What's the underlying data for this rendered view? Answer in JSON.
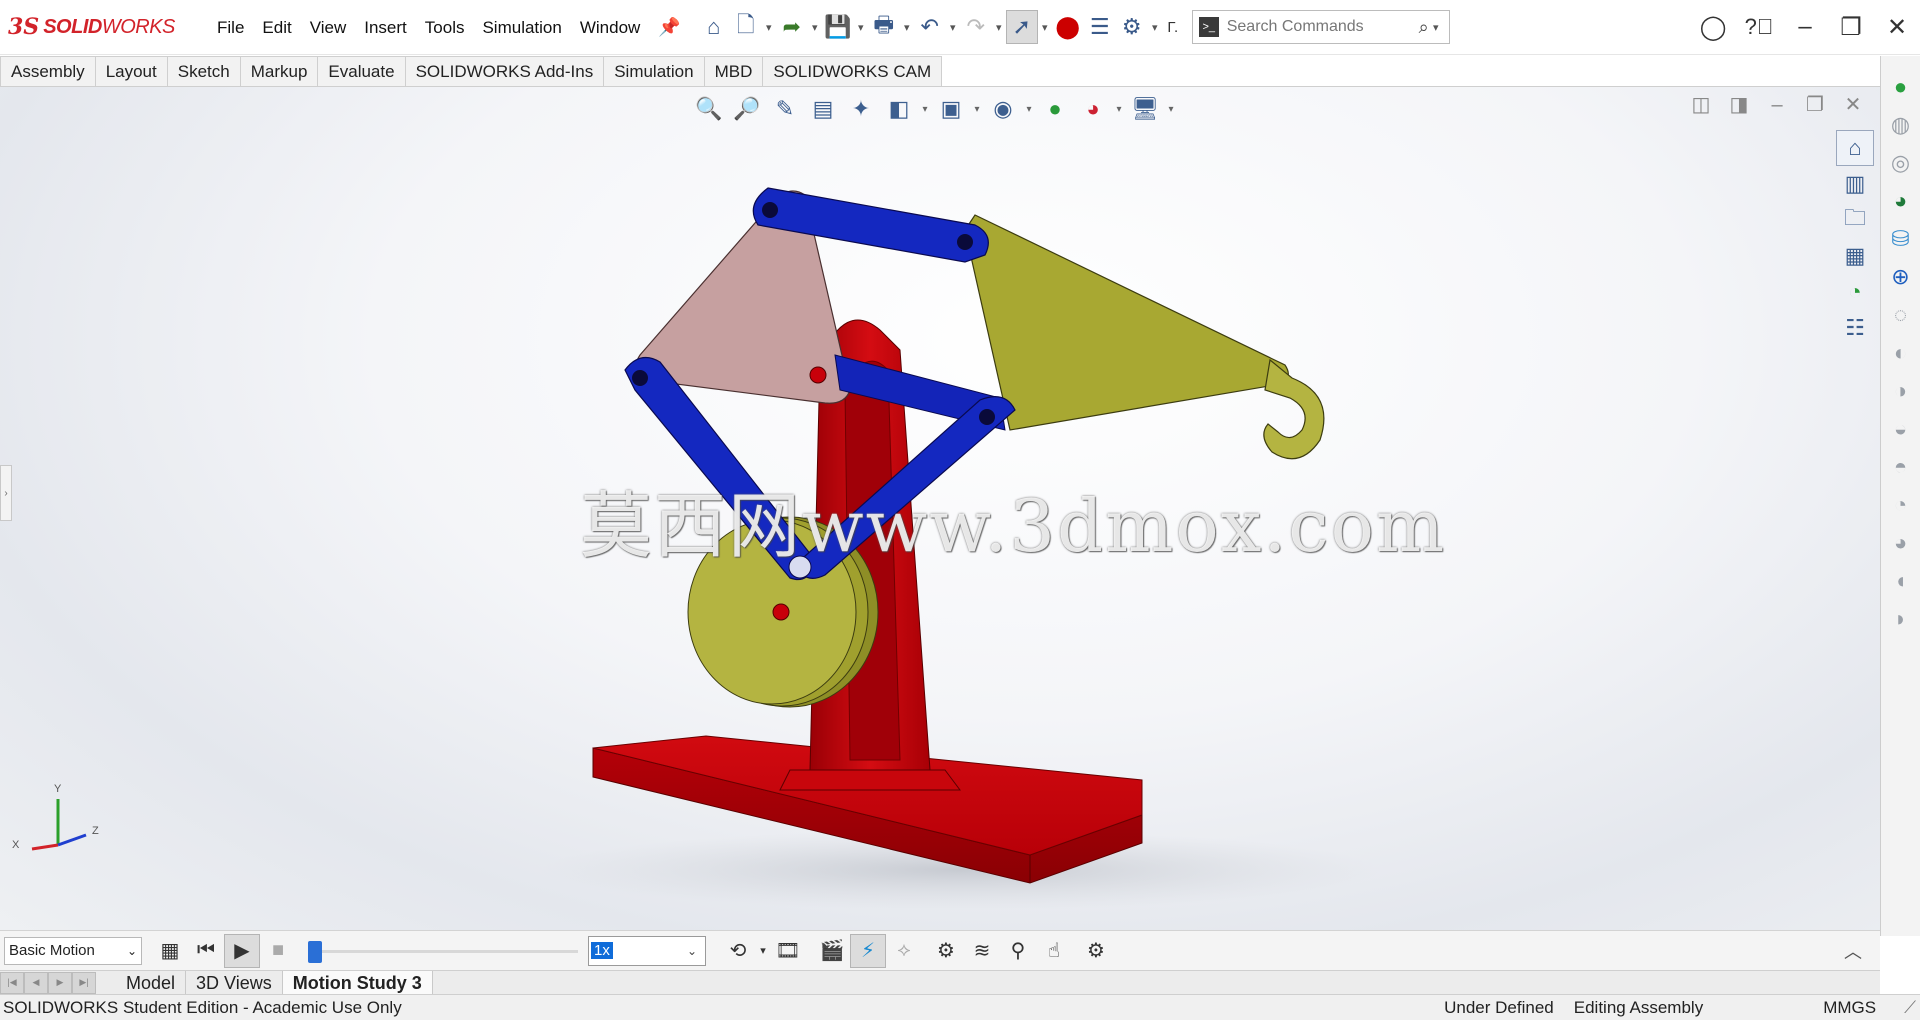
{
  "app": {
    "logo_mark": "3S",
    "logo_text_1": "SOLID",
    "logo_text_2": "WORKS"
  },
  "menu": [
    "File",
    "Edit",
    "View",
    "Insert",
    "Tools",
    "Simulation",
    "Window"
  ],
  "toolbar": {
    "overflow_label": "Γ.",
    "search_placeholder": "Search Commands"
  },
  "command_tabs": [
    "Assembly",
    "Layout",
    "Sketch",
    "Markup",
    "Evaluate",
    "SOLIDWORKS Add-Ins",
    "Simulation",
    "MBD",
    "SOLIDWORKS CAM"
  ],
  "viewport": {
    "watermark": "莫西网www.3dmox.com",
    "triad": {
      "x": "X",
      "y": "Y",
      "z": "Z"
    },
    "colors": {
      "base": "#c8000a",
      "links": "#1020b0",
      "plate": "#c6a0a0",
      "arm": "#a8a832",
      "wheel": "#b0b040"
    }
  },
  "motion": {
    "study_type": "Basic Motion",
    "speed": "1x",
    "timeline_position": 0.0
  },
  "doc_tabs": [
    {
      "label": "Model",
      "active": false
    },
    {
      "label": "3D Views",
      "active": false
    },
    {
      "label": "Motion Study 3",
      "active": true
    }
  ],
  "status": {
    "edition": "SOLIDWORKS Student Edition - Academic Use Only",
    "definition": "Under Defined",
    "mode": "Editing Assembly",
    "units": "MMGS"
  }
}
